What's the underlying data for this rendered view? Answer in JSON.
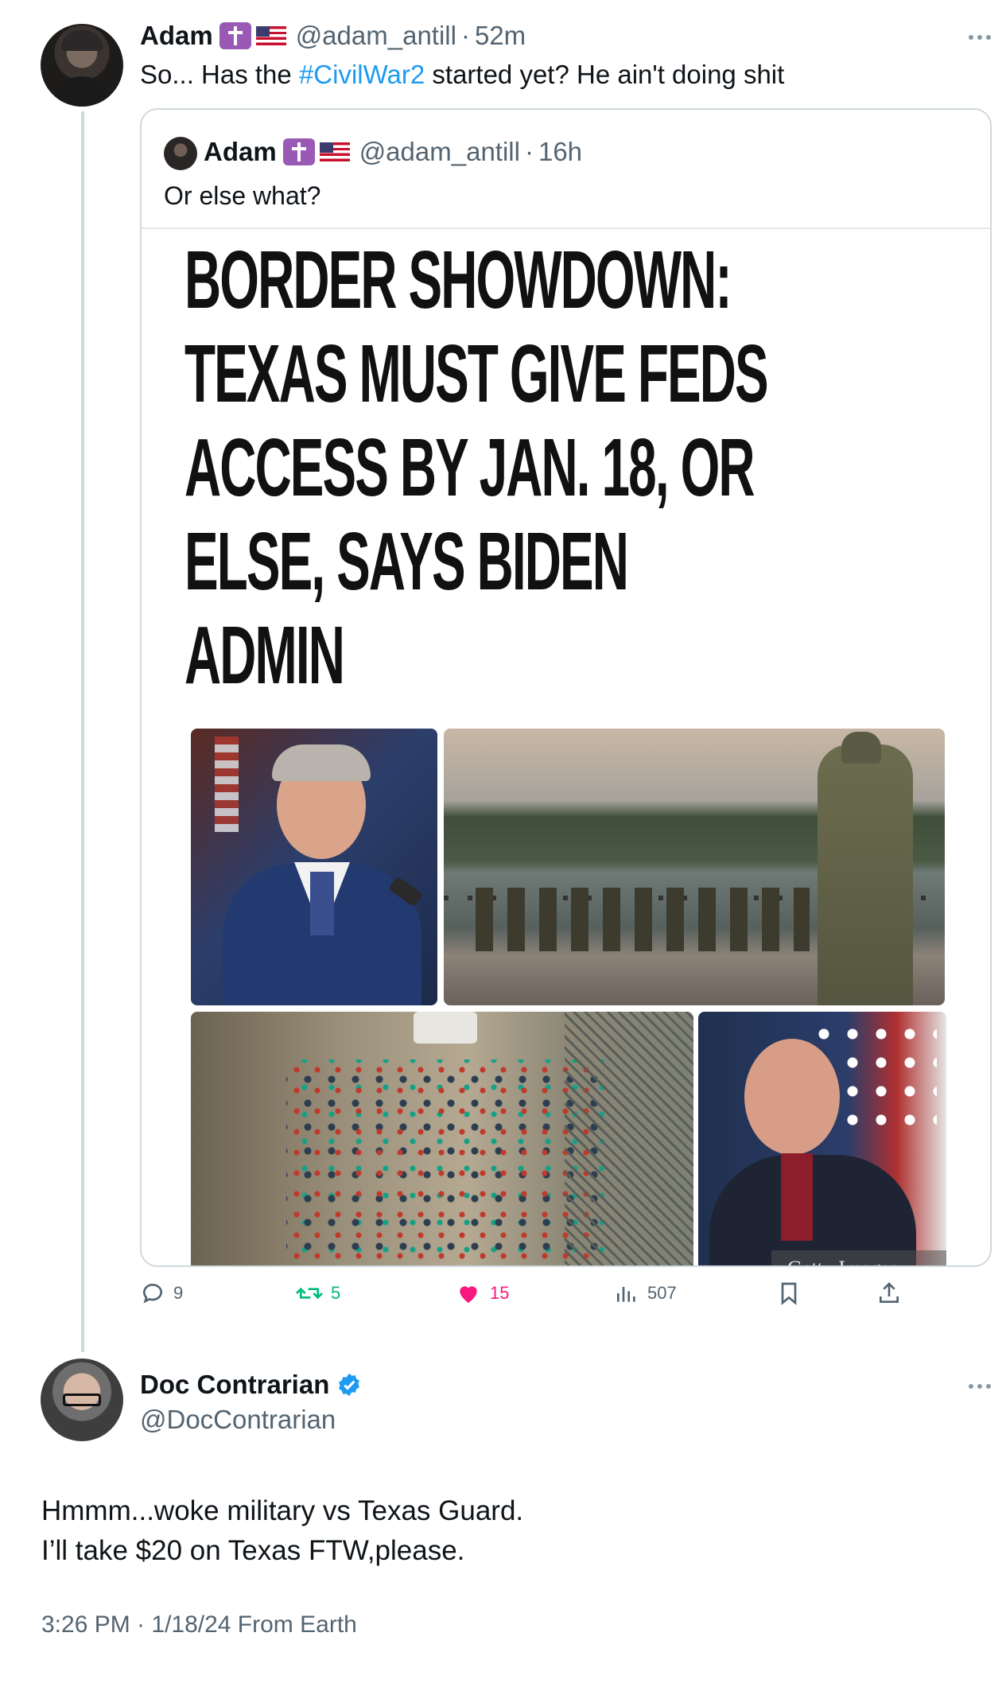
{
  "thread": {
    "tweet1": {
      "name": "Adam",
      "handle": "@adam_antill",
      "sep": "·",
      "time": "52m",
      "text_before": "So... Has the ",
      "hashtag": "#CivilWar2",
      "text_after": " started yet? He ain't doing shit"
    },
    "quote": {
      "name": "Adam",
      "handle": "@adam_antill",
      "sep": "·",
      "time": "16h",
      "text": "Or else what?",
      "headline_lines": [
        "BORDER SHOWDOWN:",
        "TEXAS MUST GIVE FEDS",
        "ACCESS BY JAN. 18, OR",
        "ELSE, SAYS BIDEN",
        "ADMIN"
      ],
      "photo_credit": "Getty Images"
    },
    "actions": {
      "replies": "9",
      "reposts": "5",
      "likes": "15",
      "views": "507"
    },
    "reply": {
      "name": "Doc Contrarian",
      "handle": "@DocContrarian",
      "line1": "Hmmm...woke military vs Texas Guard.",
      "line2": "I’ll take $20 on Texas FTW,please.",
      "meta": "3:26 PM · 1/18/24 From Earth"
    }
  },
  "colors": {
    "text": "#0f1419",
    "secondary": "#536471",
    "link": "#1d9bf0",
    "like": "#f91880",
    "repost": "#00ba7c",
    "verified": "#1d9bf0"
  },
  "icons": [
    "reply-icon",
    "repost-icon",
    "like-icon",
    "views-icon",
    "bookmark-icon",
    "share-icon",
    "more-icon",
    "verified-icon"
  ]
}
